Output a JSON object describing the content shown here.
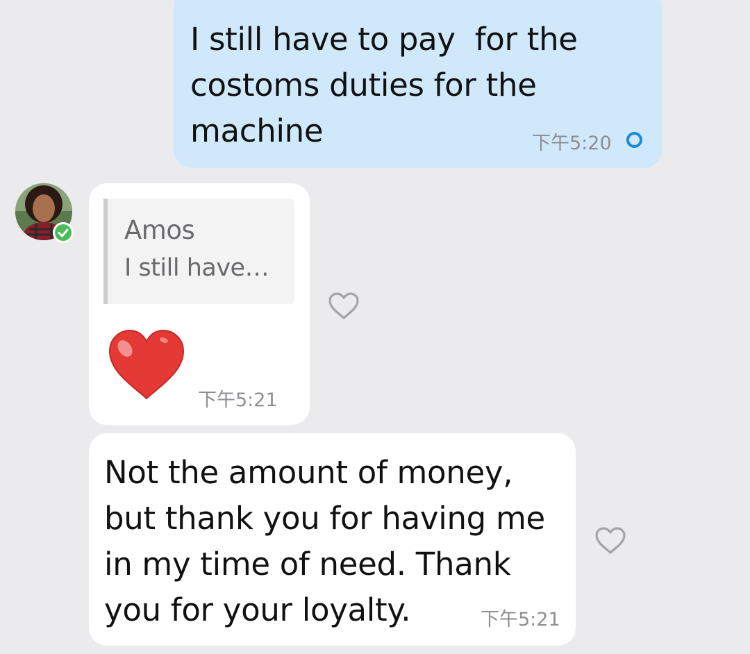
{
  "messages": {
    "outgoing": {
      "text": "I still have to pay  for the\ncostoms duties for the\nmachine",
      "time": "下午5:20"
    },
    "reply": {
      "quote_name": "Amos",
      "quote_text": "I still have…",
      "emoji": "red-heart",
      "time": "下午5:21"
    },
    "last": {
      "text": "Not the amount of money,\nbut thank you for having me\nin my time of need. Thank\nyou for your loyalty.",
      "time": "下午5:21"
    }
  },
  "colors": {
    "background": "#ebebed",
    "outgoing_bubble": "#cfe9fb",
    "incoming_bubble": "#ffffff",
    "status_dot": "#1c8ad9",
    "verified_badge": "#4cbb5a",
    "heart": "#e53935"
  },
  "icons": {
    "status": "sent-status-circle-icon",
    "verified": "verified-check-icon",
    "reaction": "heart-outline-icon"
  }
}
